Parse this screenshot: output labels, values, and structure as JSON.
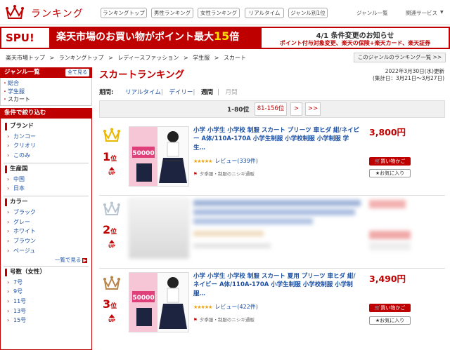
{
  "header": {
    "logo": "ランキング",
    "tabs": [
      "ランキングトップ",
      "男性ランキング",
      "女性ランキング",
      "リアルタイム",
      "ジャンル別1位"
    ],
    "links": [
      "ジャンル一覧",
      "関連サービス"
    ]
  },
  "banner": {
    "spu": "SPU!",
    "main_prefix": "楽天市場のお買い物がポイント最大",
    "main_num": "15",
    "main_suffix": "倍",
    "notice_title": "4/1 条件変更のお知らせ",
    "notice_detail": "ポイント付与対象変更、楽天の保険+楽天カード、楽天証券"
  },
  "breadcrumb": [
    "楽天市場トップ",
    ">",
    "ランキングトップ",
    ">",
    "レディースファッション",
    ">",
    "学生服",
    ">",
    "スカート"
  ],
  "genre_ranking_link": "このジャンルのランキング一覧 >>",
  "sidebar": {
    "genre_title": "ジャンル一覧",
    "all_button": "全て見る",
    "genres": [
      "総合",
      "学生服",
      "スカート"
    ],
    "filter_title": "条件で絞り込む",
    "groups": [
      {
        "title": "ブランド",
        "items": [
          "カンコー",
          "クリオリ",
          "このみ"
        ]
      },
      {
        "title": "生産国",
        "items": [
          "中国",
          "日本"
        ]
      },
      {
        "title": "カラー",
        "items": [
          "ブラック",
          "グレー",
          "ホワイト",
          "ブラウン",
          "ベージュ"
        ]
      },
      {
        "title": "号数（女性）",
        "items": [
          "7号",
          "9号",
          "11号",
          "13号",
          "15号"
        ]
      }
    ],
    "more_label": "一覧で見る"
  },
  "main": {
    "title": "スカートランキング",
    "updated": "2022年3月30日(水)更新",
    "period_note": "(集計日：3月21日～3月27日)",
    "period_label": "期間:",
    "periods": [
      "リアルタイム",
      "デイリー",
      "週間",
      "月間"
    ],
    "pager_current": "1-80位",
    "pager_next": "81-156位",
    "pager_gt": ">",
    "pager_gtgt": ">>"
  },
  "items": [
    {
      "rank": "1",
      "rank_suffix": "位",
      "up": "UP",
      "name": "小学 小学生 小学校 制服 スカート プリーツ 車ヒダ 紺/ネイビー A体/110A-170A 小学生制服 小学校制服 小学制服 学生…",
      "stars": "★★★★★",
      "review": "レビュー(339件)",
      "shop": "夕季服・制服のニシキ通販",
      "price": "3,800円",
      "buy": "買い物かご",
      "fav": "お気に入り",
      "thumb_text": "50000",
      "crown_color": "#e8b800"
    },
    {
      "rank": "2",
      "rank_suffix": "位",
      "up": "UP",
      "name": "",
      "stars": "",
      "review": "",
      "shop": "",
      "price": "",
      "buy": "買い物かご",
      "fav": "お気に入り",
      "thumb_text": "",
      "crown_color": "#b8c4d0"
    },
    {
      "rank": "3",
      "rank_suffix": "位",
      "up": "UP",
      "name": "小学 小学生 小学校 制服 スカート 夏用 プリーツ 車ヒダ 紺/ネイビー A体/110A-170A 小学生制服 小学校制服 小学制服…",
      "stars": "★★★★★",
      "review": "レビュー(422件)",
      "shop": "夕季服・制服のニシキ通販",
      "price": "3,490円",
      "buy": "買い物かご",
      "fav": "お気に入り",
      "thumb_text": "50000",
      "crown_color": "#b8864a"
    }
  ],
  "colors": {
    "accent": "#bf0000",
    "link": "#1a4fa3"
  }
}
